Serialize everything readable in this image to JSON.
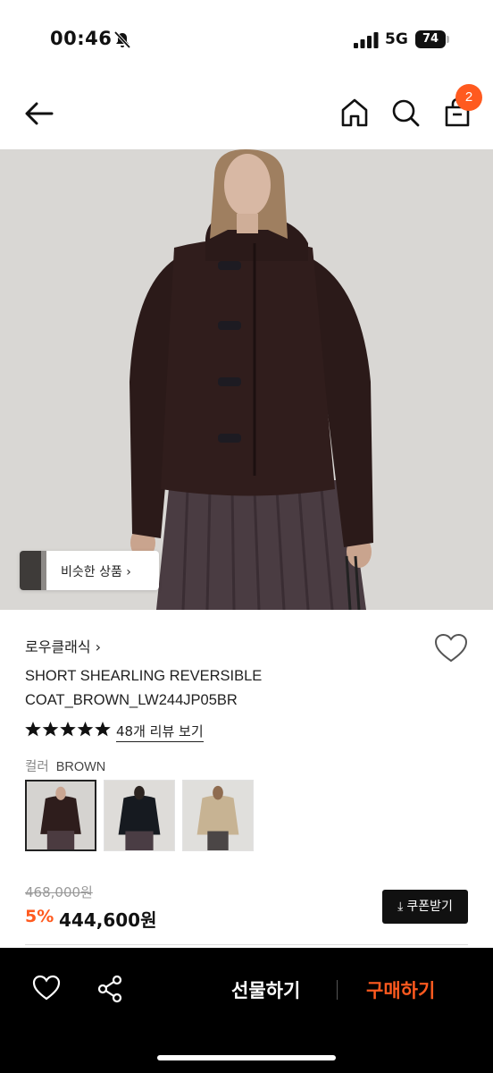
{
  "status_bar": {
    "time": "00:46",
    "network": "5G",
    "battery": "74"
  },
  "nav": {
    "cart_count": "2",
    "icons": [
      "back-arrow-icon",
      "home-icon",
      "search-icon",
      "shopping-bag-icon"
    ]
  },
  "hero": {
    "similar_label": "비슷한 상품 ›"
  },
  "product": {
    "brand": "로우클래식 ›",
    "name_line1": "SHORT SHEARLING REVERSIBLE",
    "name_line2": "COAT_BROWN_LW244JP05BR",
    "rating_stars": 5,
    "reviews_link": "48개 리뷰 보기",
    "color_label": "컬러",
    "color_value": "BROWN",
    "swatches": [
      "brown",
      "black",
      "beige"
    ],
    "original_price": "468,000원",
    "discount": "5%",
    "price": "444,600원",
    "coupon_label": "쿠폰받기"
  },
  "bottom_bar": {
    "gift_label": "선물하기",
    "buy_label": "구매하기"
  },
  "colors": {
    "accent": "#ff5a1f",
    "text": "#111111",
    "bottom_bar": "#000000"
  }
}
